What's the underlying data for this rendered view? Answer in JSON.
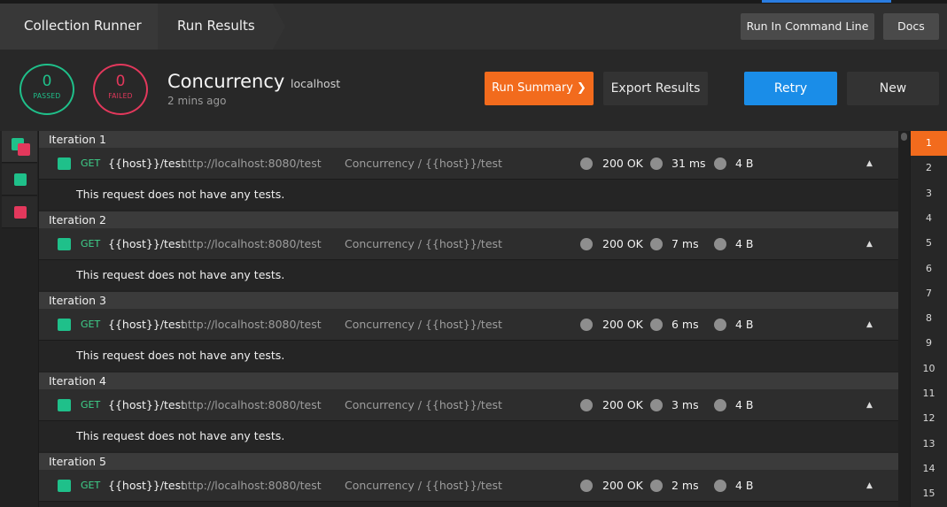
{
  "breadcrumbs": [
    "Collection Runner",
    "Run Results"
  ],
  "topbar": {
    "cmd_label": "Run In Command Line",
    "docs_label": "Docs"
  },
  "summary": {
    "passed_count": "0",
    "passed_label": "PASSED",
    "failed_count": "0",
    "failed_label": "FAILED",
    "title": "Concurrency",
    "environment": "localhost",
    "time_ago": "2 mins ago"
  },
  "actions": {
    "run_summary": "Run Summary",
    "export": "Export Results",
    "retry": "Retry",
    "new": "New"
  },
  "colors": {
    "pass": "#1fc08a",
    "fail": "#e3385c",
    "accent": "#f26b1d",
    "primary": "#1a8de8"
  },
  "iterations": [
    {
      "label": "Iteration 1",
      "method": "GET",
      "name": "{{host}}/test",
      "url": "http://localhost:8080/test",
      "path": "Concurrency / {{host}}/test",
      "status": "200 OK",
      "time": "31 ms",
      "size": "4 B",
      "note": "This request does not have any tests."
    },
    {
      "label": "Iteration 2",
      "method": "GET",
      "name": "{{host}}/test",
      "url": "http://localhost:8080/test",
      "path": "Concurrency / {{host}}/test",
      "status": "200 OK",
      "time": "7 ms",
      "size": "4 B",
      "note": "This request does not have any tests."
    },
    {
      "label": "Iteration 3",
      "method": "GET",
      "name": "{{host}}/test",
      "url": "http://localhost:8080/test",
      "path": "Concurrency / {{host}}/test",
      "status": "200 OK",
      "time": "6 ms",
      "size": "4 B",
      "note": "This request does not have any tests."
    },
    {
      "label": "Iteration 4",
      "method": "GET",
      "name": "{{host}}/test",
      "url": "http://localhost:8080/test",
      "path": "Concurrency / {{host}}/test",
      "status": "200 OK",
      "time": "3 ms",
      "size": "4 B",
      "note": "This request does not have any tests."
    },
    {
      "label": "Iteration 5",
      "method": "GET",
      "name": "{{host}}/test",
      "url": "http://localhost:8080/test",
      "path": "Concurrency / {{host}}/test",
      "status": "200 OK",
      "time": "2 ms",
      "size": "4 B"
    }
  ],
  "iteration_numbers": [
    "1",
    "2",
    "3",
    "4",
    "5",
    "6",
    "7",
    "8",
    "9",
    "10",
    "11",
    "12",
    "13",
    "14",
    "15"
  ],
  "active_iteration": "1"
}
